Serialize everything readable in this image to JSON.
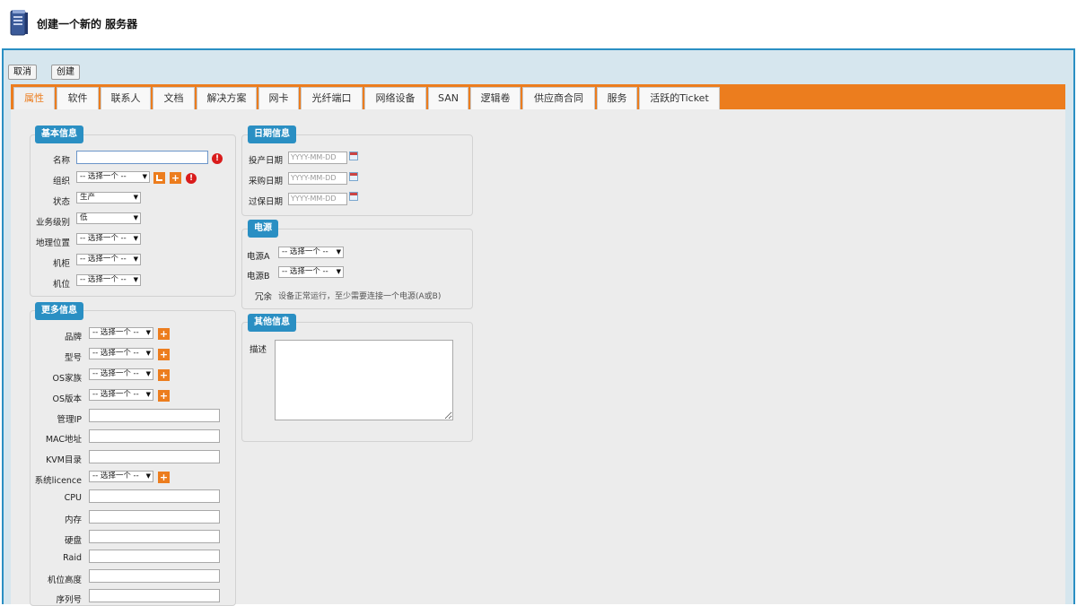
{
  "header": {
    "title": "创建一个新的 服务器",
    "icon": "server-icon"
  },
  "toolbar": {
    "cancel_label": "取消",
    "create_label": "创建"
  },
  "tabs": [
    {
      "label": "属性",
      "active": true
    },
    {
      "label": "软件"
    },
    {
      "label": "联系人"
    },
    {
      "label": "文档"
    },
    {
      "label": "解决方案"
    },
    {
      "label": "网卡"
    },
    {
      "label": "光纤端口"
    },
    {
      "label": "网络设备"
    },
    {
      "label": "SAN"
    },
    {
      "label": "逻辑卷"
    },
    {
      "label": "供应商合同"
    },
    {
      "label": "服务"
    },
    {
      "label": "活跃的Ticket"
    }
  ],
  "basic": {
    "legend": "基本信息",
    "name_label": "名称",
    "org_label": "组织",
    "org_value": "-- 选择一个 --",
    "status_label": "状态",
    "status_value": "生产",
    "business_label": "业务级别",
    "business_value": "低",
    "location_label": "地理位置",
    "location_value": "-- 选择一个 --",
    "rack_label": "机柜",
    "rack_value": "-- 选择一个 --",
    "enclosure_label": "机位",
    "enclosure_value": "-- 选择一个 --",
    "required_mark": "!"
  },
  "more": {
    "legend": "更多信息",
    "brand_label": "品牌",
    "brand_value": "-- 选择一个 --",
    "model_label": "型号",
    "model_value": "-- 选择一个 --",
    "osfamily_label": "OS家族",
    "osfamily_value": "-- 选择一个 --",
    "osversion_label": "OS版本",
    "osversion_value": "-- 选择一个 --",
    "mgmtip_label": "管理IP",
    "mac_label": "MAC地址",
    "kvm_label": "KVM目录",
    "license_label": "系统licence",
    "license_value": "-- 选择一个 --",
    "cpu_label": "CPU",
    "ram_label": "内存",
    "disk_label": "硬盘",
    "raid_label": "Raid",
    "height_label": "机位高度",
    "serial_label": "序列号"
  },
  "dates": {
    "legend": "日期信息",
    "prod_label": "投产日期",
    "purchase_label": "采购日期",
    "warranty_label": "过保日期",
    "placeholder": "YYYY-MM-DD"
  },
  "power": {
    "legend": "电源",
    "a_label": "电源A",
    "a_value": "-- 选择一个 --",
    "b_label": "电源B",
    "b_value": "-- 选择一个 --",
    "redundancy_label": "冗余",
    "redundancy_text": "设备正常运行，至少需要连接一个电源(A或B)"
  },
  "other": {
    "legend": "其他信息",
    "desc_label": "描述"
  },
  "colors": {
    "accent": "#ec7d1e",
    "frame": "#2a8fc3",
    "legend": "#2a8fc3",
    "error": "#d91b1b"
  }
}
